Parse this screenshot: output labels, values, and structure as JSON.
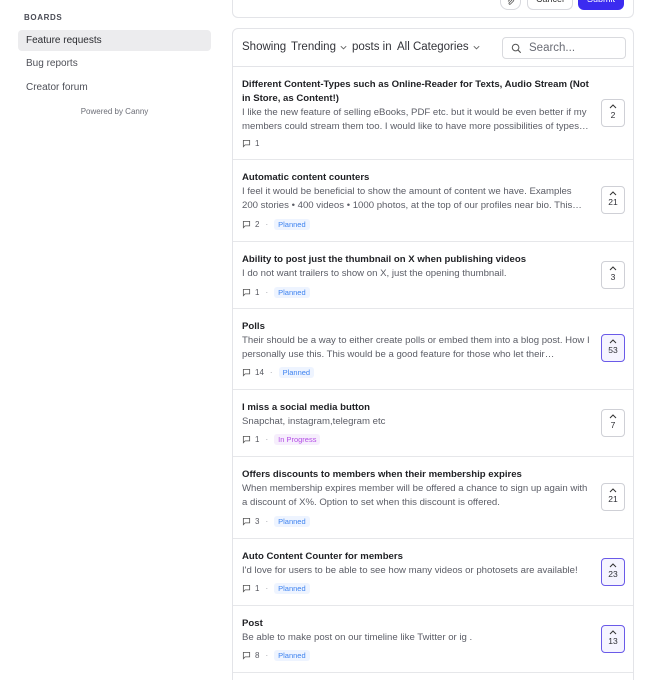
{
  "sidebar": {
    "heading": "BOARDS",
    "boards": [
      {
        "label": "Feature requests",
        "active": true
      },
      {
        "label": "Bug reports",
        "active": false
      },
      {
        "label": "Creator forum",
        "active": false
      }
    ],
    "powered_by": "Powered by Canny"
  },
  "composer": {
    "cancel_label": "Cancel",
    "submit_label": "Submit",
    "attach_icon": "paperclip-icon",
    "accent": "#3b2bf0"
  },
  "filters": {
    "showing_label": "Showing",
    "sort_value": "Trending",
    "posts_in_label": "posts in",
    "category_value": "All Categories",
    "search_placeholder": "Search..."
  },
  "posts": [
    {
      "title": "Different Content-Types such as Online-Reader for Texts, Audio Stream (Not in Store, as Content!)",
      "desc": "I like the new feature of selling eBooks, PDF etc. but it would be even better if my members could stream them too. I would like to have more possibilities of types of content to sell.",
      "comments": "1",
      "status": "",
      "votes": "2",
      "voted": false
    },
    {
      "title": "Automatic content counters",
      "desc": "I feel it would be beneficial to show the amount of content we have. Examples 200 stories • 400 videos • 1000 photos, at the top of our profiles near bio. This would help people see what they get.",
      "comments": "2",
      "status": "Planned",
      "votes": "21",
      "voted": false
    },
    {
      "title": "Ability to post just the thumbnail on X when publishing videos",
      "desc": "I do not want trailers to show on X, just the opening thumbnail.",
      "comments": "1",
      "status": "Planned",
      "votes": "3",
      "voted": false
    },
    {
      "title": "Polls",
      "desc": "Their should be a way to either create polls or embed them into a blog post. How I personally use this. This would be a good feature for those who let their subscribers decide.",
      "comments": "14",
      "status": "Planned",
      "votes": "53",
      "voted": true
    },
    {
      "title": "I miss a social media button",
      "desc": "Snapchat, instagram,telegram etc",
      "comments": "1",
      "status": "In Progress",
      "votes": "7",
      "voted": false
    },
    {
      "title": "Offers discounts to members when their membership expires",
      "desc": "When membership expires member will be offered a chance to sign up again with a discount of X%. Option to set when this discount is offered.",
      "comments": "3",
      "status": "Planned",
      "votes": "21",
      "voted": false
    },
    {
      "title": "Auto Content Counter for members",
      "desc": "I'd love for users to be able to see how many videos or photosets are available!",
      "comments": "1",
      "status": "Planned",
      "votes": "23",
      "voted": true
    },
    {
      "title": "Post",
      "desc": "Be able to make post on our timeline like Twitter or ig .",
      "comments": "8",
      "status": "Planned",
      "votes": "13",
      "voted": true
    }
  ]
}
